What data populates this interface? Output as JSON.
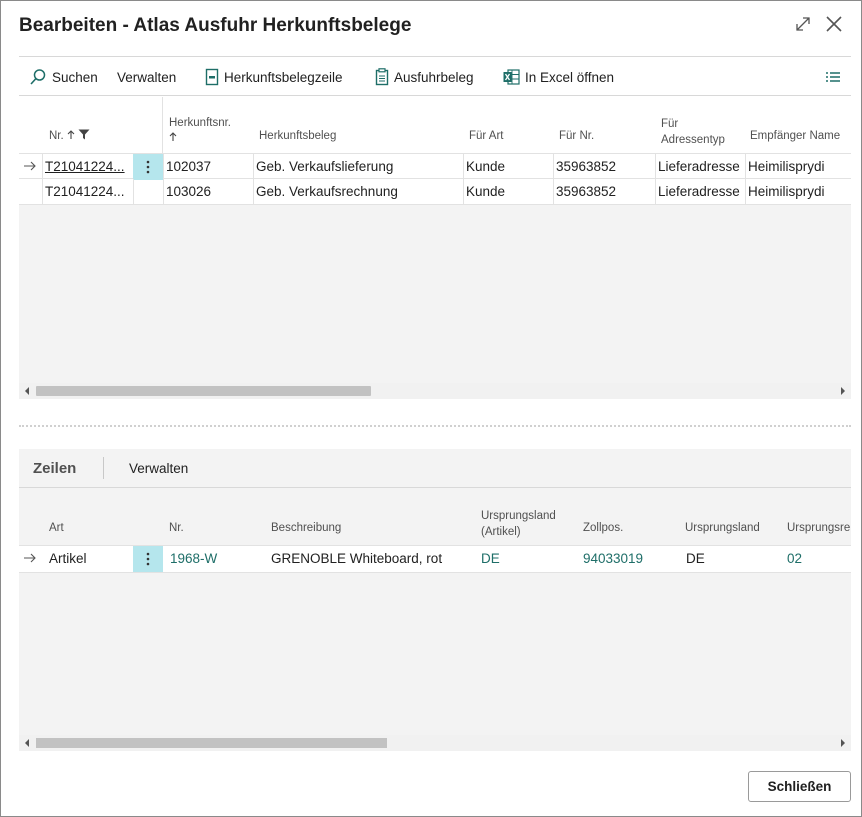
{
  "window": {
    "title": "Bearbeiten - Atlas Ausfuhr Herkunftsbelege"
  },
  "actions": {
    "search": "Suchen",
    "manage": "Verwalten",
    "source_line": "Herkunftsbelegzeile",
    "export_doc": "Ausfuhrbeleg",
    "excel": "In Excel öffnen"
  },
  "header_grid": {
    "columns": {
      "nr": "Nr.",
      "herkunftsnr": "Herkunftsnr.",
      "herkunftsbeleg": "Herkunftsbeleg",
      "fuer_art": "Für Art",
      "fuer_nr": "Für Nr.",
      "fuer_adressentyp_1": "Für",
      "fuer_adressentyp_2": "Adressentyp",
      "empfaenger_name": "Empfänger Name"
    },
    "rows": [
      {
        "nr": "T21041224...",
        "herkunftsnr": "102037",
        "herkunftsbeleg": "Geb. Verkaufslieferung",
        "fuer_art": "Kunde",
        "fuer_nr": "35963852",
        "adressentyp": "Lieferadresse",
        "empfaenger": "Heimilisprydi"
      },
      {
        "nr": "T21041224...",
        "herkunftsnr": "103026",
        "herkunftsbeleg": "Geb. Verkaufsrechnung",
        "fuer_art": "Kunde",
        "fuer_nr": "35963852",
        "adressentyp": "Lieferadresse",
        "empfaenger": "Heimilisprydi"
      }
    ]
  },
  "lines_part": {
    "title": "Zeilen",
    "manage": "Verwalten",
    "columns": {
      "art": "Art",
      "nr": "Nr.",
      "beschreibung": "Beschreibung",
      "ursprungsland_artikel_1": "Ursprungsland",
      "ursprungsland_artikel_2": "(Artikel)",
      "zollpos": "Zollpos.",
      "ursprungsland": "Ursprungsland",
      "ursprungsre": "Ursprungsre"
    },
    "rows": [
      {
        "art": "Artikel",
        "nr": "1968-W",
        "beschreibung": "GRENOBLE Whiteboard, rot",
        "ursprungsland_artikel": "DE",
        "zollpos": "94033019",
        "ursprungsland": "DE",
        "ursprungsre": "02"
      }
    ]
  },
  "footer": {
    "close": "Schließen"
  },
  "colors": {
    "accent_link": "#1e6e68",
    "selected_cell": "#b5e6ed",
    "icon_teal": "#1e6e68"
  }
}
